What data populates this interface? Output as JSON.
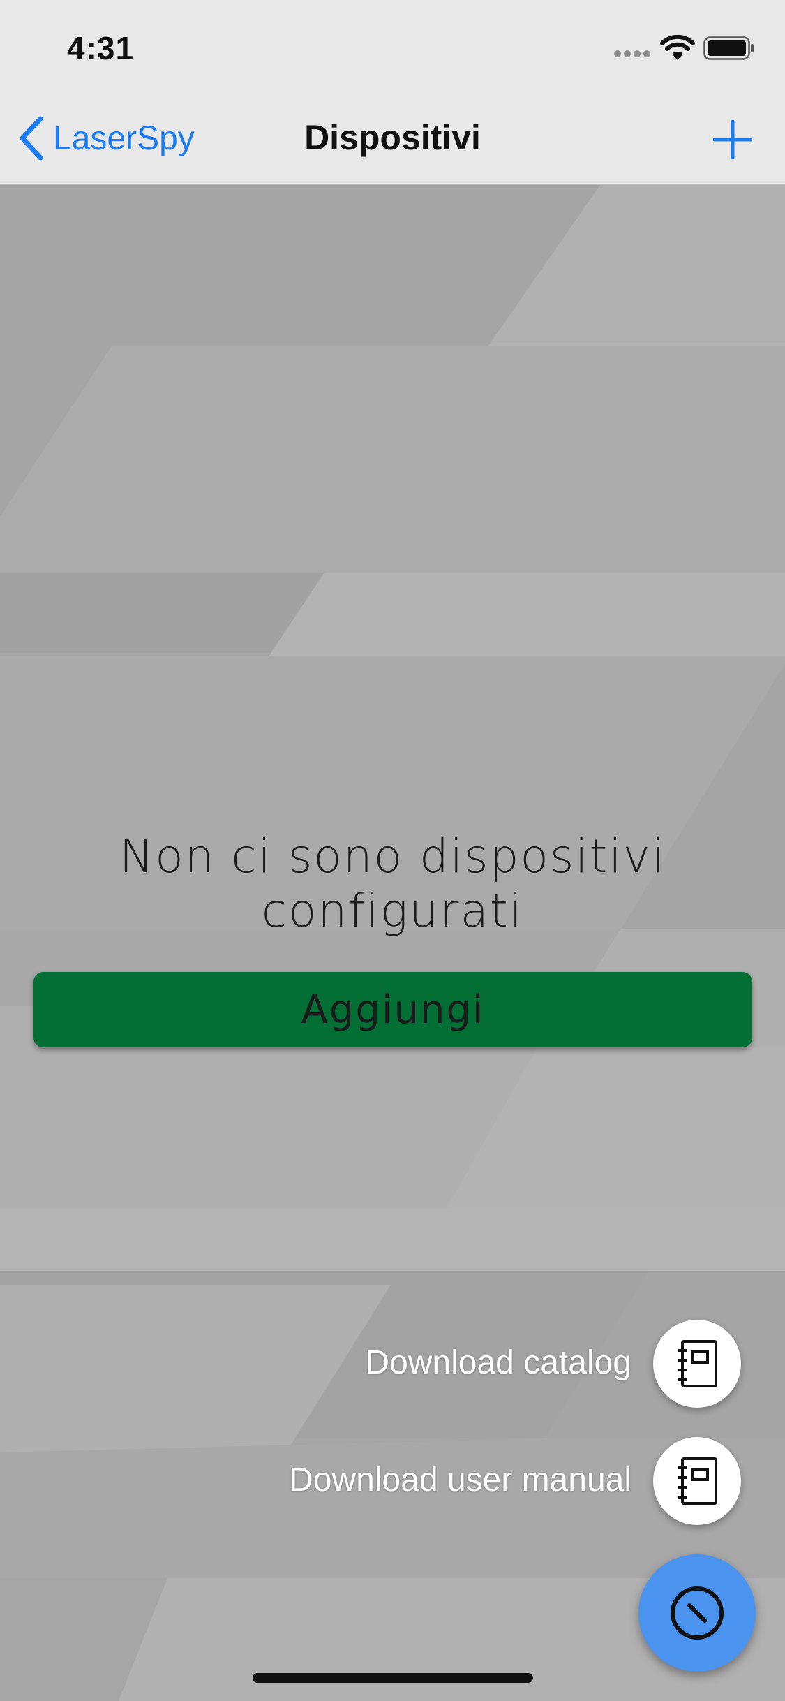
{
  "status_bar": {
    "time": "4:31"
  },
  "nav": {
    "back_label": "LaserSpy",
    "title": "Dispositivi"
  },
  "empty_state": {
    "message_line1": "Non ci sono dispositivi",
    "message_line2": "configurati",
    "add_button_label": "Aggiungi"
  },
  "fab_menu": {
    "items": [
      {
        "label": "Download catalog",
        "icon": "catalog-book-icon"
      },
      {
        "label": "Download user manual",
        "icon": "manual-book-icon"
      }
    ],
    "main_icon": "compass-icon"
  },
  "colors": {
    "accent_blue": "#1a7cf2",
    "button_green": "#036f35",
    "fab_blue": "#4a94f0",
    "bar_background": "#e8e8e8",
    "content_background": "#a7a7a8"
  }
}
